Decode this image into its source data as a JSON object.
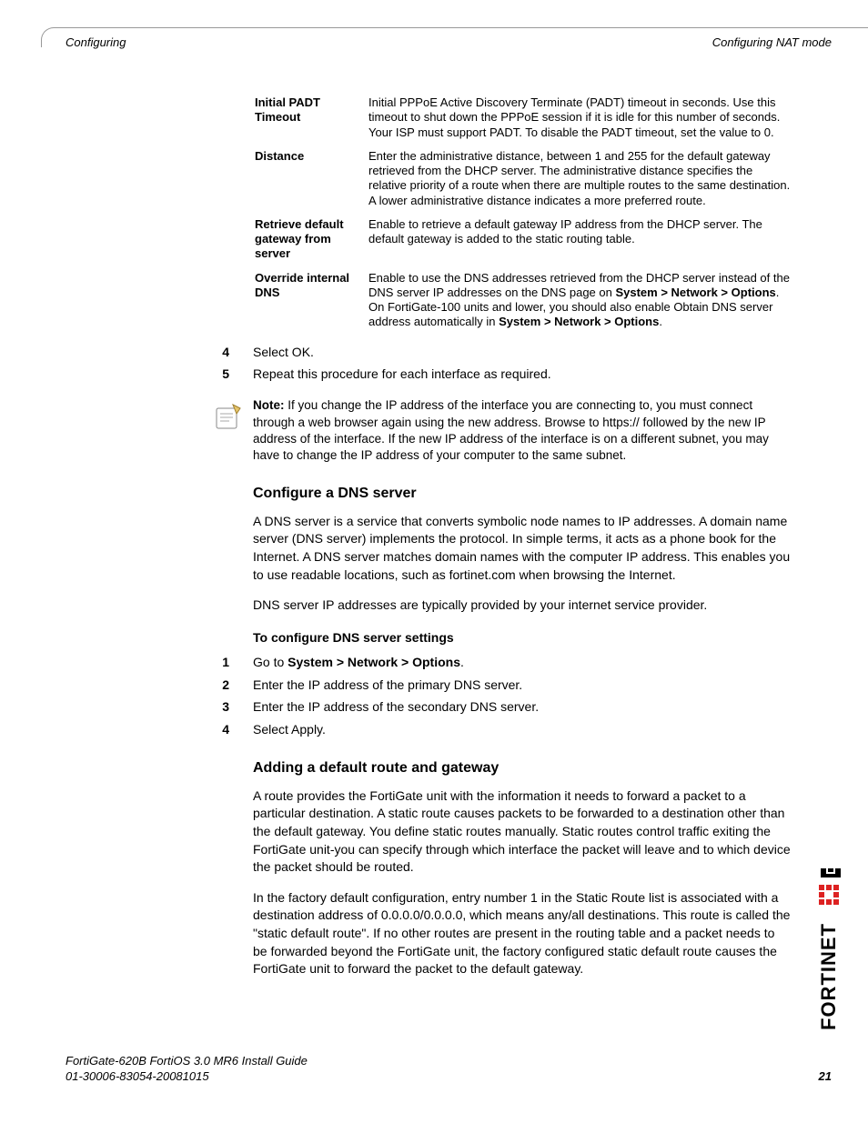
{
  "header": {
    "left": "Configuring",
    "right": "Configuring NAT mode"
  },
  "defs": [
    {
      "term": "Initial PADT Timeout",
      "desc": "Initial PPPoE Active Discovery Terminate (PADT) timeout in seconds. Use this timeout to shut down the PPPoE session if it is idle for this number of seconds. Your ISP must support PADT. To disable the PADT timeout, set the value to 0."
    },
    {
      "term": "Distance",
      "desc": "Enter the administrative distance, between 1 and 255 for the default gateway retrieved from the DHCP server. The administrative distance specifies the relative priority of a route when there are multiple routes to the same destination. A lower administrative distance indicates a more preferred route."
    },
    {
      "term": "Retrieve default gateway from server",
      "desc": "Enable to retrieve a default gateway IP address from the DHCP server. The default gateway is added to the static routing table."
    },
    {
      "term": "Override internal DNS",
      "desc_parts": [
        "Enable to use the DNS addresses retrieved from the DHCP server instead of the DNS server IP addresses on the DNS page on ",
        "System > Network > Options",
        ". On FortiGate-100 units and lower, you should also enable Obtain DNS server address automatically in ",
        "System > Network > Options",
        "."
      ]
    }
  ],
  "steps_top": [
    {
      "n": "4",
      "t": "Select OK."
    },
    {
      "n": "5",
      "t": "Repeat this procedure for each interface as required."
    }
  ],
  "note": {
    "label": "Note:",
    "text": " If you change the IP address of the interface you are connecting to, you must connect through a web browser again using the new address. Browse to https:// followed by the new IP address of the interface. If the new IP address of the interface is on a different subnet, you may have to change the IP address of your computer to the same subnet."
  },
  "dns": {
    "title": "Configure a DNS server",
    "p1": "A DNS server is a service that converts symbolic node names to IP addresses. A domain name server (DNS server) implements the protocol. In simple terms, it acts as a phone book for the Internet. A DNS server matches domain names with the computer IP address. This enables you to use readable locations, such as fortinet.com when browsing the Internet.",
    "p2": "DNS server IP addresses are typically provided by your internet service provider.",
    "proc_title": "To configure DNS server settings",
    "steps": [
      {
        "n": "1",
        "pre": "Go to ",
        "bold": "System > Network > Options",
        "post": "."
      },
      {
        "n": "2",
        "t": "Enter the IP address of the primary DNS server."
      },
      {
        "n": "3",
        "t": "Enter the IP address of the secondary DNS server."
      },
      {
        "n": "4",
        "t": "Select Apply."
      }
    ]
  },
  "route": {
    "title": "Adding a default route and gateway",
    "p1": "A route provides the FortiGate unit with the information it needs to forward a packet to a particular destination. A static route causes packets to be forwarded to a destination other than the default gateway. You define static routes manually. Static routes control traffic exiting the FortiGate unit-you can specify through which interface the packet will leave and to which device the packet should be routed.",
    "p2": "In the factory default configuration, entry number 1 in the Static Route list is associated with a destination address of 0.0.0.0/0.0.0.0, which means any/all destinations. This route is called the \"static default route\". If no other routes are present in the routing table and a packet needs to be forwarded beyond the FortiGate unit, the factory configured static default route causes the FortiGate unit to forward the packet to the default gateway."
  },
  "footer": {
    "line1": "FortiGate-620B FortiOS 3.0 MR6 Install Guide",
    "line2": "01-30006-83054-20081015",
    "page": "21"
  }
}
